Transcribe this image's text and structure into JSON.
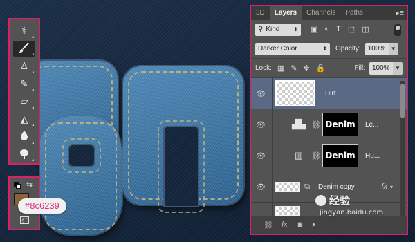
{
  "tools_panel": {
    "tools": [
      {
        "icon": "spot-healing-brush-icon",
        "glyph": "⚕"
      },
      {
        "icon": "brush-icon",
        "glyph": "🖌",
        "active": true
      },
      {
        "icon": "clone-stamp-icon",
        "glyph": "♙"
      },
      {
        "icon": "history-brush-icon",
        "glyph": "✎"
      },
      {
        "icon": "eraser-icon",
        "glyph": "▱"
      },
      {
        "icon": "paint-bucket-icon",
        "glyph": "◭"
      },
      {
        "icon": "blur-icon",
        "glyph": "💧"
      },
      {
        "icon": "dodge-icon",
        "glyph": "●"
      }
    ]
  },
  "colors": {
    "foreground": "#8c6239",
    "hex_label": "#8c6239"
  },
  "layers_panel": {
    "tabs": [
      {
        "label": "3D",
        "active": false
      },
      {
        "label": "Layers",
        "active": true
      },
      {
        "label": "Channels",
        "active": false
      },
      {
        "label": "Paths",
        "active": false
      }
    ],
    "filter": {
      "label": "Kind"
    },
    "blend_mode": "Darker Color",
    "opacity_label": "Opacity:",
    "opacity_value": "100%",
    "lock_label": "Lock:",
    "fill_label": "Fill:",
    "fill_value": "100%",
    "layers": [
      {
        "name": "Dirt",
        "type": "pixel",
        "selected": true
      },
      {
        "name": "Le...",
        "type": "levels",
        "mask_text": "Denim",
        "icon": "levels-icon"
      },
      {
        "name": "Hu...",
        "type": "hue-saturation",
        "mask_text": "Denim",
        "icon": "hue-saturation-icon"
      },
      {
        "name": "Denim copy",
        "type": "pixel-fx",
        "fx": "fx"
      }
    ]
  },
  "watermark": {
    "main_text": "经验",
    "url": "jingyan.baidu.com"
  },
  "accent_color": "#d8206b"
}
